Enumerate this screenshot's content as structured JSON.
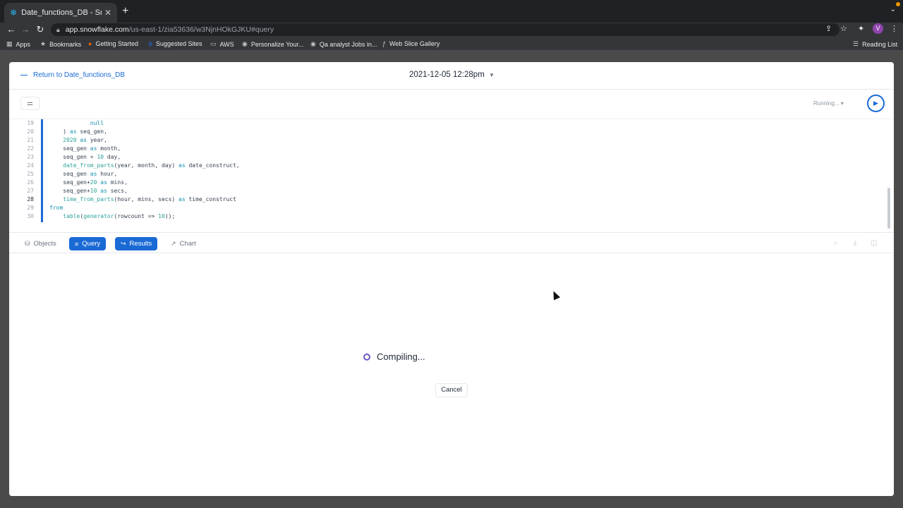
{
  "browser": {
    "tab_title": "Date_functions_DB - Snowflak",
    "tab_favicon": "snowflake-icon",
    "new_tab_label": "+",
    "url_host": "app.snowflake.com",
    "url_path": "/us-east-1/zia53636/w3NjnHOkGJKU#query",
    "avatar_initial": "V",
    "bookmarks": [
      {
        "label": "Apps",
        "icon": "grid-icon"
      },
      {
        "label": "Bookmarks",
        "icon": "star-icon"
      },
      {
        "label": "Getting Started",
        "icon": "firefox-icon"
      },
      {
        "label": "Suggested Sites",
        "icon": "bing-icon"
      },
      {
        "label": "AWS",
        "icon": "folder-icon"
      },
      {
        "label": "Personalize Your...",
        "icon": "globe-icon"
      },
      {
        "label": "Qa analyst Jobs in...",
        "icon": "globe-icon"
      },
      {
        "label": "Web Slice Gallery",
        "icon": "slice-icon"
      }
    ],
    "reading_list": "Reading List"
  },
  "header": {
    "return_label": "Return to Date_functions_DB",
    "timestamp": "2021-12-05 12:28pm"
  },
  "run": {
    "status": "Running..."
  },
  "editor": {
    "lines": [
      {
        "num": "19",
        "code": "            null"
      },
      {
        "num": "20",
        "code": "    ) as seq_gen,"
      },
      {
        "num": "21",
        "code": "    2020 as year,"
      },
      {
        "num": "22",
        "code": "    seq_gen as month,"
      },
      {
        "num": "23",
        "code": "    seq_gen + 10 day,"
      },
      {
        "num": "24",
        "code": "    date_from_parts(year, month, day) as date_construct,"
      },
      {
        "num": "25",
        "code": "    seq_gen as hour,"
      },
      {
        "num": "26",
        "code": "    seq_gen+20 as mins,"
      },
      {
        "num": "27",
        "code": "    seq_gen+10 as secs,"
      },
      {
        "num": "28",
        "code": "    time_from_parts(hour, mins, secs) as time_construct"
      },
      {
        "num": "29",
        "code": "from"
      },
      {
        "num": "30",
        "code": "    table(generator(rowcount => 10));"
      }
    ],
    "active_line": "28"
  },
  "panel_tabs": {
    "objects": "Objects",
    "query": "Query",
    "results": "Results",
    "chart": "Chart"
  },
  "results": {
    "compiling": "Compiling...",
    "cancel": "Cancel"
  }
}
